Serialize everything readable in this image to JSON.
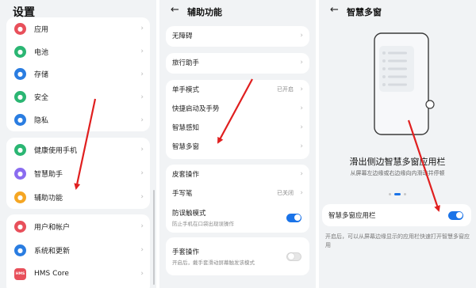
{
  "panel1": {
    "title": "设置",
    "groups": [
      [
        {
          "label": "应用",
          "icon": "apps-icon",
          "color": "#e8505b"
        },
        {
          "label": "电池",
          "icon": "battery-icon",
          "color": "#2bb673"
        },
        {
          "label": "存储",
          "icon": "storage-icon",
          "color": "#2a7de1"
        },
        {
          "label": "安全",
          "icon": "security-icon",
          "color": "#2bb673"
        },
        {
          "label": "隐私",
          "icon": "privacy-icon",
          "color": "#2a7de1"
        }
      ],
      [
        {
          "label": "健康使用手机",
          "icon": "digital-balance-icon",
          "color": "#2bb673"
        },
        {
          "label": "智慧助手",
          "icon": "smart-assistant-icon",
          "color": "#8a6cf0"
        },
        {
          "label": "辅助功能",
          "icon": "accessibility-icon",
          "color": "#f5a623"
        }
      ],
      [
        {
          "label": "用户和帐户",
          "icon": "user-icon",
          "color": "#e8505b"
        },
        {
          "label": "系统和更新",
          "icon": "system-icon",
          "color": "#2a7de1"
        },
        {
          "label": "HMS Core",
          "icon": "hms-icon",
          "color": "#e8505b",
          "glyph": "HMS"
        }
      ]
    ]
  },
  "panel2": {
    "title": "辅助功能",
    "cards": [
      [
        {
          "label": "无障碍"
        }
      ],
      [
        {
          "label": "旅行助手"
        }
      ],
      [
        {
          "label": "单手模式",
          "value": "已开启"
        },
        {
          "label": "快捷启动及手势"
        },
        {
          "label": "智慧感知"
        },
        {
          "label": "智慧多窗"
        }
      ],
      [
        {
          "label": "皮套操作"
        },
        {
          "label": "手写笔",
          "value": "已关闭"
        },
        {
          "label": "防误触模式",
          "sub": "防止手机在口袋出现误操作",
          "toggle": "on"
        }
      ],
      [
        {
          "label": "手套操作",
          "sub": "开启后，戴手套滑动屏幕触发该模式",
          "toggle": "off"
        }
      ]
    ]
  },
  "panel3": {
    "title": "智慧多窗",
    "feature_title": "滑出侧边智慧多窗应用栏",
    "feature_desc": "从屏幕左边缘或右边缘向内滑动并停顿",
    "setting_label": "智慧多窗应用栏",
    "setting_toggle": "on",
    "footer": "开启后，可以从屏幕边缘显示的应用栏快速打开智慧多窗应用"
  },
  "colors": {
    "accent": "#1a73e8",
    "arrow": "#e01f1f",
    "background": "#f1f3f5"
  }
}
